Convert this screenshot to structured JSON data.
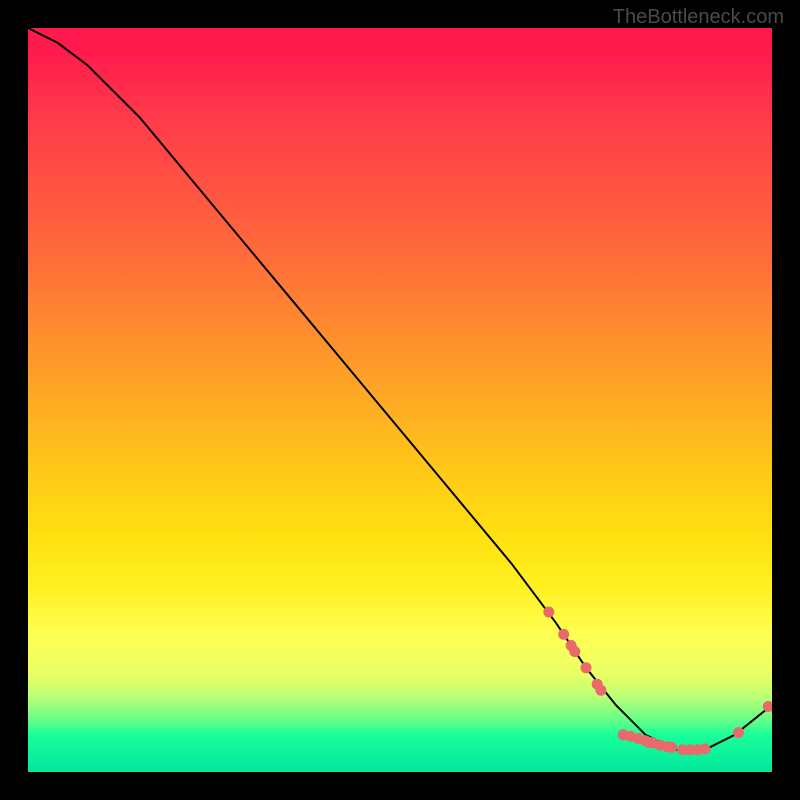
{
  "watermark": "TheBottleneck.com",
  "chart_data": {
    "type": "line",
    "title": "",
    "xlabel": "",
    "ylabel": "",
    "xlim": [
      0,
      100
    ],
    "ylim": [
      0,
      100
    ],
    "series": [
      {
        "name": "curve",
        "x": [
          0,
          4,
          8,
          15,
          25,
          35,
          45,
          55,
          65,
          71,
          75,
          79,
          83,
          87,
          91,
          95,
          100
        ],
        "y": [
          100,
          98,
          95,
          88,
          76,
          64,
          52,
          40,
          28,
          20,
          14,
          9,
          5,
          3,
          3,
          5,
          9
        ]
      }
    ],
    "markers": [
      {
        "x": 70,
        "y": 21.5
      },
      {
        "x": 72,
        "y": 18.5
      },
      {
        "x": 73,
        "y": 17
      },
      {
        "x": 73.5,
        "y": 16.2
      },
      {
        "x": 75,
        "y": 14
      },
      {
        "x": 76.5,
        "y": 11.8
      },
      {
        "x": 77,
        "y": 11
      },
      {
        "x": 80,
        "y": 5
      },
      {
        "x": 81,
        "y": 4.8
      },
      {
        "x": 82,
        "y": 4.5
      },
      {
        "x": 83,
        "y": 4.2
      },
      {
        "x": 83.5,
        "y": 4
      },
      {
        "x": 84,
        "y": 3.9
      },
      {
        "x": 85,
        "y": 3.6
      },
      {
        "x": 86,
        "y": 3.4
      },
      {
        "x": 86.5,
        "y": 3.3
      },
      {
        "x": 88,
        "y": 3
      },
      {
        "x": 89,
        "y": 3
      },
      {
        "x": 90,
        "y": 3
      },
      {
        "x": 91,
        "y": 3.1
      },
      {
        "x": 95.5,
        "y": 5.3
      },
      {
        "x": 99.5,
        "y": 8.8
      }
    ]
  }
}
